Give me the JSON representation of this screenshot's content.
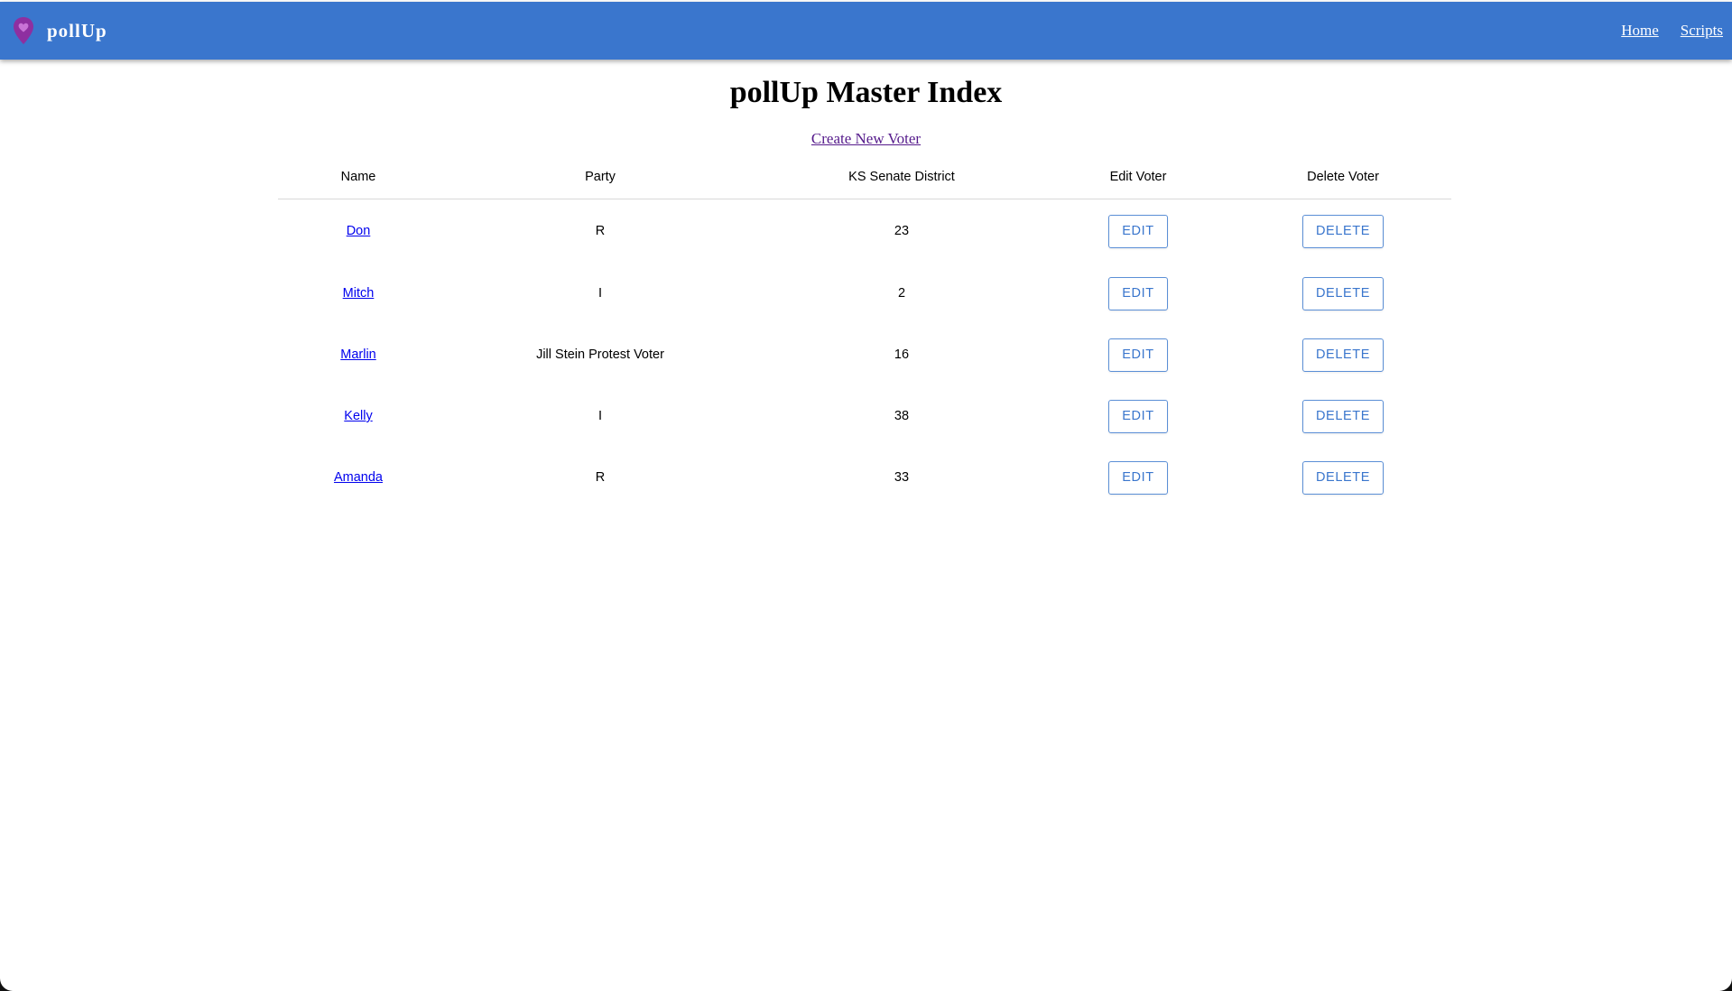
{
  "app": {
    "name": "pollUp",
    "logo_icon": "map-pin-heart-icon",
    "brand_color": "#3a76cd",
    "logo_color": "#8e2fa0"
  },
  "nav": {
    "links": [
      {
        "label": "Home"
      },
      {
        "label": "Scripts"
      }
    ]
  },
  "page": {
    "title": "pollUp Master Index",
    "create_link": "Create New Voter"
  },
  "table": {
    "headers": {
      "name": "Name",
      "party": "Party",
      "district": "KS Senate District",
      "edit": "Edit Voter",
      "delete": "Delete Voter"
    },
    "edit_label": "EDIT",
    "delete_label": "DELETE",
    "rows": [
      {
        "name": "Don",
        "party": "R",
        "district": "23"
      },
      {
        "name": "Mitch",
        "party": "I",
        "district": "2"
      },
      {
        "name": "Marlin",
        "party": "Jill Stein Protest Voter",
        "district": "16"
      },
      {
        "name": "Kelly",
        "party": "I",
        "district": "38"
      },
      {
        "name": "Amanda",
        "party": "R",
        "district": "33"
      }
    ]
  }
}
